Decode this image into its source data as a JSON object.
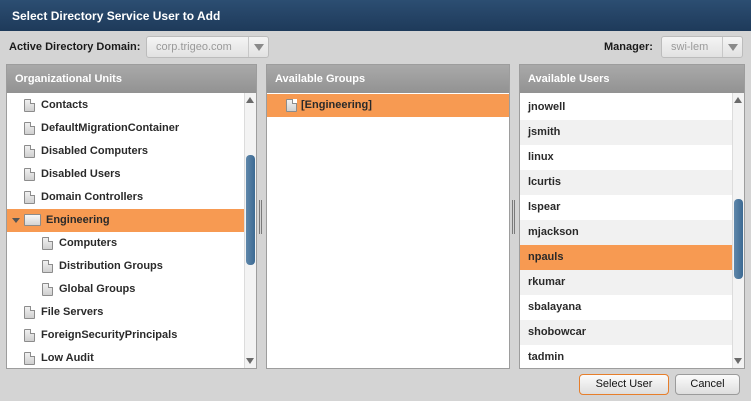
{
  "window": {
    "title": "Select Directory Service User to Add"
  },
  "toolbar": {
    "domain_label": "Active Directory Domain:",
    "domain_value": "corp.trigeo.com",
    "manager_label": "Manager:",
    "manager_value": "swi-lem"
  },
  "org_units": {
    "header": "Organizational Units",
    "items": [
      {
        "label": "Contacts",
        "level": 0,
        "icon": "doc-icon"
      },
      {
        "label": "DefaultMigrationContainer",
        "level": 0,
        "icon": "doc-icon"
      },
      {
        "label": "Disabled Computers",
        "level": 0,
        "icon": "doc-icon"
      },
      {
        "label": "Disabled Users",
        "level": 0,
        "icon": "doc-icon"
      },
      {
        "label": "Domain Controllers",
        "level": 0,
        "icon": "doc-icon"
      },
      {
        "label": "Engineering",
        "level": 0,
        "icon": "folder-open-icon",
        "selected": true,
        "expanded": true
      },
      {
        "label": "Computers",
        "level": 1,
        "icon": "doc-icon"
      },
      {
        "label": "Distribution Groups",
        "level": 1,
        "icon": "doc-icon"
      },
      {
        "label": "Global Groups",
        "level": 1,
        "icon": "doc-icon"
      },
      {
        "label": "File Servers",
        "level": 0,
        "icon": "doc-icon"
      },
      {
        "label": "ForeignSecurityPrincipals",
        "level": 0,
        "icon": "doc-icon"
      },
      {
        "label": "Low Audit",
        "level": 0,
        "icon": "doc-icon"
      }
    ]
  },
  "groups": {
    "header": "Available Groups",
    "items": [
      {
        "label": "[Engineering]",
        "icon": "doc-icon",
        "selected": true
      }
    ]
  },
  "users": {
    "header": "Available Users",
    "items": [
      {
        "label": "jnowell"
      },
      {
        "label": "jsmith"
      },
      {
        "label": "linux"
      },
      {
        "label": "lcurtis"
      },
      {
        "label": "lspear"
      },
      {
        "label": "mjackson"
      },
      {
        "label": "npauls",
        "selected": true
      },
      {
        "label": "rkumar"
      },
      {
        "label": "sbalayana"
      },
      {
        "label": "shobowcar"
      },
      {
        "label": "tadmin"
      }
    ]
  },
  "buttons": {
    "select": "Select User",
    "cancel": "Cancel"
  },
  "colors": {
    "selection": "#f79a52",
    "titlebar": "#233f61",
    "scroll_thumb": "#4a78a0"
  },
  "scroll": {
    "org_units_position": 0.35,
    "users_position": 0.55
  }
}
